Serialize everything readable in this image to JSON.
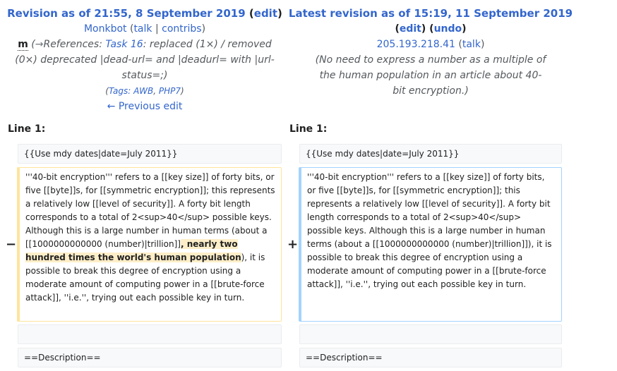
{
  "left": {
    "title_prefix": "Revision as of 21:55, 8 September 2019",
    "edit": "edit",
    "user": "Monkbot",
    "talk": "talk",
    "contribs": "contribs",
    "minor": "m",
    "summary_arrow": "→",
    "summary_section": "References: ",
    "summary_task_link": "Task 16",
    "summary_rest": ": replaced (1×) / removed (0×) deprecated |dead-url= and |deadurl= with |url-status=;)",
    "tags_label": "Tags: ",
    "tag1": "AWB",
    "tag2": "PHP7",
    "prev_edit": "← Previous edit",
    "line_label": "Line 1:",
    "ctx1": "{{Use mdy dates|date=July 2011}}",
    "del_before": "'''40-bit encryption''' refers to a [[key size]] of forty bits, or five [[byte]]s, for [[symmetric encryption]]; this represents a relatively low [[level of security]]. A forty bit length corresponds to a total of 2<sup>40</sup> possible keys. Although this is a large number in human terms (about a [[1000000000000 (number)|trillion]]",
    "del_highlight": ", nearly two hundred times the world's human population",
    "del_after": "), it is possible to break this degree of encryption using a moderate amount of computing power in a [[brute-force attack]], ''i.e.'', trying out each possible key in turn.",
    "ctx2": "",
    "ctx3": "==Description=="
  },
  "right": {
    "title_prefix": "Latest revision as of 15:19, 11 September 2019",
    "edit": "edit",
    "undo": "undo",
    "user": "205.193.218.41",
    "talk": "talk",
    "summary": "(No need to express a number as a multiple of the human population in an article about 40-bit encryption.)",
    "line_label": "Line 1:",
    "ctx1": "{{Use mdy dates|date=July 2011}}",
    "add_text": "'''40-bit encryption''' refers to a [[key size]] of forty bits, or five [[byte]]s, for [[symmetric encryption]]; this represents a relatively low [[level of security]]. A forty bit length corresponds to a total of 2<sup>40</sup> possible keys. Although this is a large number in human terms (about a [[1000000000000 (number)|trillion]]), it is possible to break this degree of encryption using a moderate amount of computing power in a [[brute-force attack]], ''i.e.'', trying out each possible key in turn.",
    "ctx2": "",
    "ctx3": "==Description=="
  },
  "markers": {
    "minus": "−",
    "plus": "+"
  },
  "punct": {
    "open": "(",
    "close": ")",
    "sep": " | ",
    "comma": ", "
  },
  "colors": {
    "link": "#3366cc",
    "deleted_border": "#ffe49c",
    "added_border": "#a3d3ff",
    "highlight": "#feeec8"
  }
}
